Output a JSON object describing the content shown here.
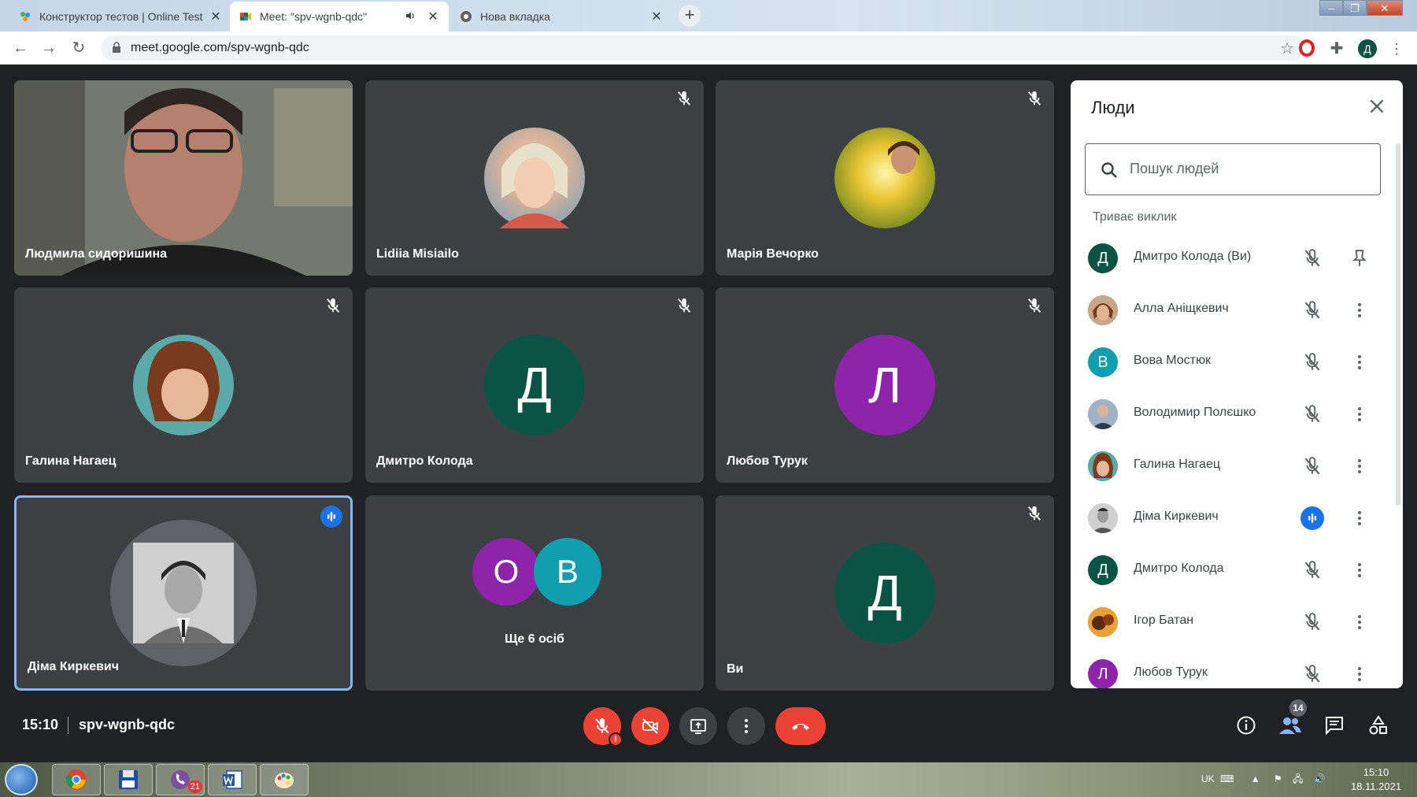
{
  "browser": {
    "tabs": [
      {
        "title": "Конструктор тестов | Online Test",
        "active": false
      },
      {
        "title": "Meet: \"spv-wgnb-qdc\"",
        "active": true
      },
      {
        "title": "Нова вкладка",
        "active": false
      }
    ],
    "url": "meet.google.com/spv-wgnb-qdc",
    "profile_letter": "Д"
  },
  "tiles": [
    {
      "name": "Людмила сидоришина",
      "type": "video",
      "muted": false
    },
    {
      "name": "Lidiia Misiailo",
      "type": "photo",
      "muted": true
    },
    {
      "name": "Марія Вечорко",
      "type": "photo",
      "muted": true
    },
    {
      "name": "Галина Нагаец",
      "type": "photo",
      "muted": true
    },
    {
      "name": "Дмитро Колода",
      "type": "letter",
      "letter": "Д",
      "color": "#0b5345",
      "muted": true
    },
    {
      "name": "Любов Турук",
      "type": "letter",
      "letter": "Л",
      "color": "#8e24aa",
      "muted": true
    },
    {
      "name": "Діма Киркевич",
      "type": "photo",
      "muted": false,
      "speaking": true
    },
    {
      "name": "Ще 6 осіб",
      "type": "group",
      "letters": [
        "О",
        "В"
      ],
      "colors": [
        "#8e24aa",
        "#129eaf"
      ]
    },
    {
      "name": "Ви",
      "type": "letter",
      "letter": "Д",
      "color": "#0b5345",
      "muted": true
    }
  ],
  "bottom": {
    "time": "15:10",
    "meeting_code": "spv-wgnb-qdc",
    "people_count": "14"
  },
  "panel": {
    "title": "Люди",
    "search_placeholder": "Пошук людей",
    "section": "Триває виклик",
    "people": [
      {
        "name": "Дмитро Колода (Ви)",
        "avatar": "letter",
        "letter": "Д",
        "color": "#0b5345",
        "status": "muted",
        "action": "pin"
      },
      {
        "name": "Алла Аніщкевич",
        "avatar": "photo",
        "color": "#9c6b4a",
        "status": "muted",
        "action": "more"
      },
      {
        "name": "Вова Мостюк",
        "avatar": "letter",
        "letter": "В",
        "color": "#129eaf",
        "status": "muted",
        "action": "more"
      },
      {
        "name": "Володимир Полєшко",
        "avatar": "photo",
        "color": "#5a6f86",
        "status": "muted",
        "action": "more"
      },
      {
        "name": "Галина Нагаец",
        "avatar": "photo",
        "color": "#8d5b3e",
        "status": "muted",
        "action": "more"
      },
      {
        "name": "Діма Киркевич",
        "avatar": "photo",
        "color": "#777777",
        "status": "speaking",
        "action": "more"
      },
      {
        "name": "Дмитро Колода",
        "avatar": "letter",
        "letter": "Д",
        "color": "#0b5345",
        "status": "muted",
        "action": "more"
      },
      {
        "name": "Ігор Батан",
        "avatar": "photo",
        "color": "#c67a1e",
        "status": "muted",
        "action": "more"
      },
      {
        "name": "Любов Турук",
        "avatar": "letter",
        "letter": "Л",
        "color": "#8e24aa",
        "status": "muted",
        "action": "more"
      }
    ]
  },
  "taskbar": {
    "viber_badge": "21",
    "lang": "UK",
    "time": "15:10",
    "date": "18.11.2021"
  }
}
